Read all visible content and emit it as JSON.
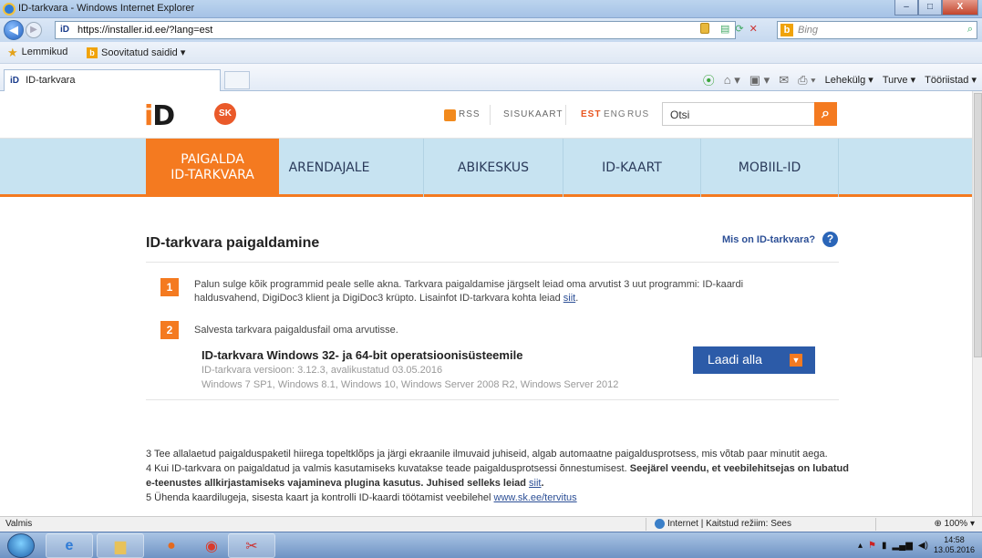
{
  "window": {
    "title": "ID-tarkvara - Windows Internet Explorer",
    "min": "–",
    "max": "□",
    "close": "X"
  },
  "address": {
    "url": "https://installer.id.ee/?lang=est",
    "id_mark": "iD",
    "search_placeholder": "Bing"
  },
  "favorites": {
    "label": "Lemmikud",
    "suggested": "Soovitatud saidid ▾"
  },
  "tab": {
    "label": "ID-tarkvara",
    "id_mark": "iD"
  },
  "command_bar": {
    "page": "Lehekülg ▾",
    "safety": "Turve ▾",
    "tools": "Tööriistad ▾"
  },
  "site": {
    "logo_text": "iD",
    "sk_logo": "SK",
    "rss": "RSS",
    "sitemap": "SISUKAART",
    "languages": [
      "EST",
      "ENG",
      "RUS"
    ],
    "search_value": "Otsi",
    "nav": [
      {
        "line1": "PAIGALDA",
        "line2": "ID-TARKVARA"
      },
      {
        "line1": "ARENDAJALE",
        "line2": ""
      },
      {
        "line1": "ABIKESKUS",
        "line2": ""
      },
      {
        "line1": "ID-KAART",
        "line2": ""
      },
      {
        "line1": "MOBIIL-ID",
        "line2": ""
      }
    ]
  },
  "main": {
    "title": "ID-tarkvara paigaldamine",
    "what_link": "Mis on ID-tarkvara?",
    "steps": [
      {
        "num": "1",
        "text": "Palun sulge kõik programmid peale selle akna. Tarkvara paigaldamise järgselt leiad oma arvutist 3 uut programmi: ID-kaardi haldusvahend, DigiDoc3 klient ja DigiDoc3 krüpto. Lisainfot ID-tarkvara kohta leiad",
        "link": "siit",
        "end": "."
      },
      {
        "num": "2",
        "text": "Salvesta tarkvara paigaldusfail oma arvutisse.",
        "link": "",
        "end": ""
      }
    ],
    "download": {
      "title": "ID-tarkvara Windows 32- ja 64-bit operatsioonisüsteemile",
      "version": "ID-tarkvara versioon: 3.12.3, avalikustatud 03.05.2016",
      "platforms": "Windows 7 SP1, Windows 8.1, Windows 10, Windows Server 2008 R2, Windows Server 2012",
      "button": "Laadi alla"
    },
    "bottom": {
      "s3": "3 Tee allalaetud paigalduspaketil hiirega topeltklõps ja järgi ekraanile ilmuvaid juhiseid, algab automaatne paigaldusprotsess, mis võtab paar minutit aega.",
      "s4_plain": "4 Kui ID-tarkvara on paigaldatud ja valmis kasutamiseks kuvatakse teade paigaldusprotsessi õnnestumisest.",
      "s4_bold": "Seejärel veendu, et veebilehitsejas on lubatud e-teenustes allkirjastamiseks vajamineva plugina kasutus. Juhised selleks leiad",
      "s4_link": "siit",
      "s5_plain": "5 Ühenda kaardilugeja, sisesta kaart ja kontrolli ID-kaardi töötamist veebilehel",
      "s5_link": "www.sk.ee/tervitus"
    }
  },
  "status": {
    "text": "Valmis",
    "zone": "Internet | Kaitstud režiim: Sees",
    "zoom": "100%"
  },
  "taskbar": {
    "time": "14:58",
    "date": "13.05.2016"
  },
  "colors": {
    "accent": "#f47a20",
    "nav_band": "#c7e3f1",
    "button_blue": "#2c5ba8"
  }
}
